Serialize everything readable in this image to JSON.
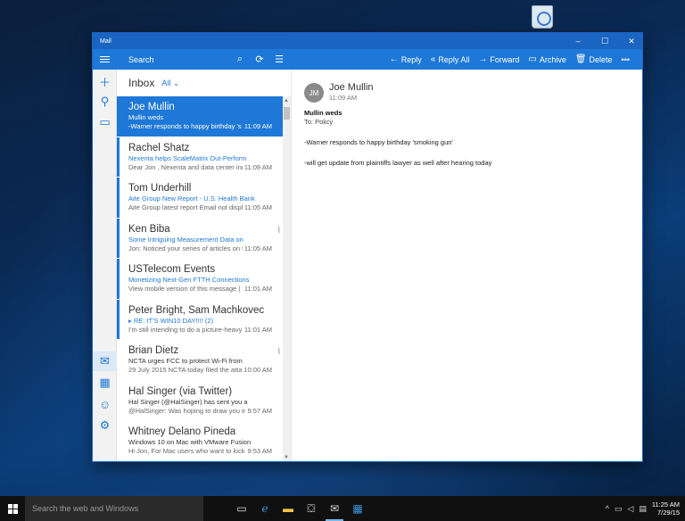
{
  "window": {
    "title": "Mail"
  },
  "toolbar": {
    "search_placeholder": "Search",
    "actions": [
      {
        "label": "Reply",
        "glyph": "←"
      },
      {
        "label": "Reply All",
        "glyph": "«"
      },
      {
        "label": "Forward",
        "glyph": "→"
      },
      {
        "label": "Archive",
        "glyph": "▭"
      },
      {
        "label": "Delete",
        "glyph": "🗑"
      },
      {
        "label": "•••",
        "glyph": ""
      }
    ]
  },
  "list": {
    "folder": "Inbox",
    "filter": "All ⌄",
    "messages": [
      {
        "from": "Joe Mullin",
        "subject": "Mullin weds",
        "preview": "-Warner responds to happy birthday 's",
        "time": "11:09 AM"
      },
      {
        "from": "Rachel Shatz",
        "subject": "Nexenta helps ScaleMatrix Out-Perform",
        "preview": "Dear Jon , Nexenta and data center inn",
        "time": "11:09 AM"
      },
      {
        "from": "Tom Underhill",
        "subject": "Aite Group New Report - U.S. Health Bank",
        "preview": "Aite Group latest report Email not displ",
        "time": "11:05 AM"
      },
      {
        "from": "Ken Biba",
        "subject": "Some Intriguing Measurement Data on",
        "preview": "Jon: Noticed your series of articles on t",
        "time": "11:05 AM"
      },
      {
        "from": "USTelecom Events",
        "subject": "Monetizing Next-Gen FTTH Connections",
        "preview": "View mobile version of this message | I",
        "time": "11:01 AM"
      },
      {
        "from": "Peter Bright, Sam Machkovec",
        "subject": "▸ RE: IT'S WIN10 DAY!!!! (2)",
        "preview": "I'm still intending to do a picture-heavy",
        "time": "11:01 AM"
      },
      {
        "from": "Brian Dietz",
        "subject": "NCTA urges FCC to protect Wi-Fi from",
        "preview": "29 July 2015 NCTA today filed the attac",
        "time": "10:00 AM"
      },
      {
        "from": "Hal Singer (via Twitter)",
        "subject": "Hal Singer (@HalSinger) has sent you a",
        "preview": "@HalSinger: Was hoping to draw you in",
        "time": "9:57 AM"
      },
      {
        "from": "Whitney Delano Pineda",
        "subject": "Windows 10 on Mac with VMware Fusion",
        "preview": "Hi Jon, For Mac users who want to kick t",
        "time": "9:53 AM"
      }
    ]
  },
  "reading": {
    "initials": "JM",
    "sender": "Joe Mullin",
    "time": "11:09 AM",
    "subject": "Mullin weds",
    "to": "To: Policy",
    "lines": [
      "-Warner responds to happy birthday 'smoking gun'",
      "-will get update from plaintiffs lawyer as well after hearing today"
    ]
  },
  "taskbar": {
    "search_placeholder": "Search the web and Windows",
    "time": "11:25 AM",
    "date": "7/29/15"
  }
}
